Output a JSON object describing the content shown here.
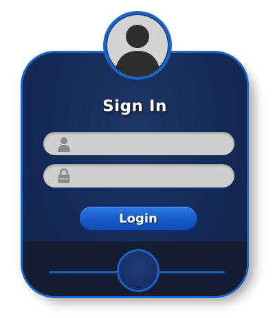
{
  "form": {
    "title": "Sign In",
    "username_value": "",
    "password_value": "",
    "login_label": "Login"
  },
  "icons": {
    "avatar": "user-avatar-icon",
    "username": "user-icon",
    "password": "lock-icon"
  },
  "colors": {
    "accent": "#1b63c9",
    "card_bg": "#152a57",
    "footer_bg": "#151d33",
    "field_bg": "#cfcfcf",
    "icon_gray": "#8a8a8a",
    "avatar_bg": "#d3d3d3",
    "avatar_fg": "#2e2e2e"
  }
}
